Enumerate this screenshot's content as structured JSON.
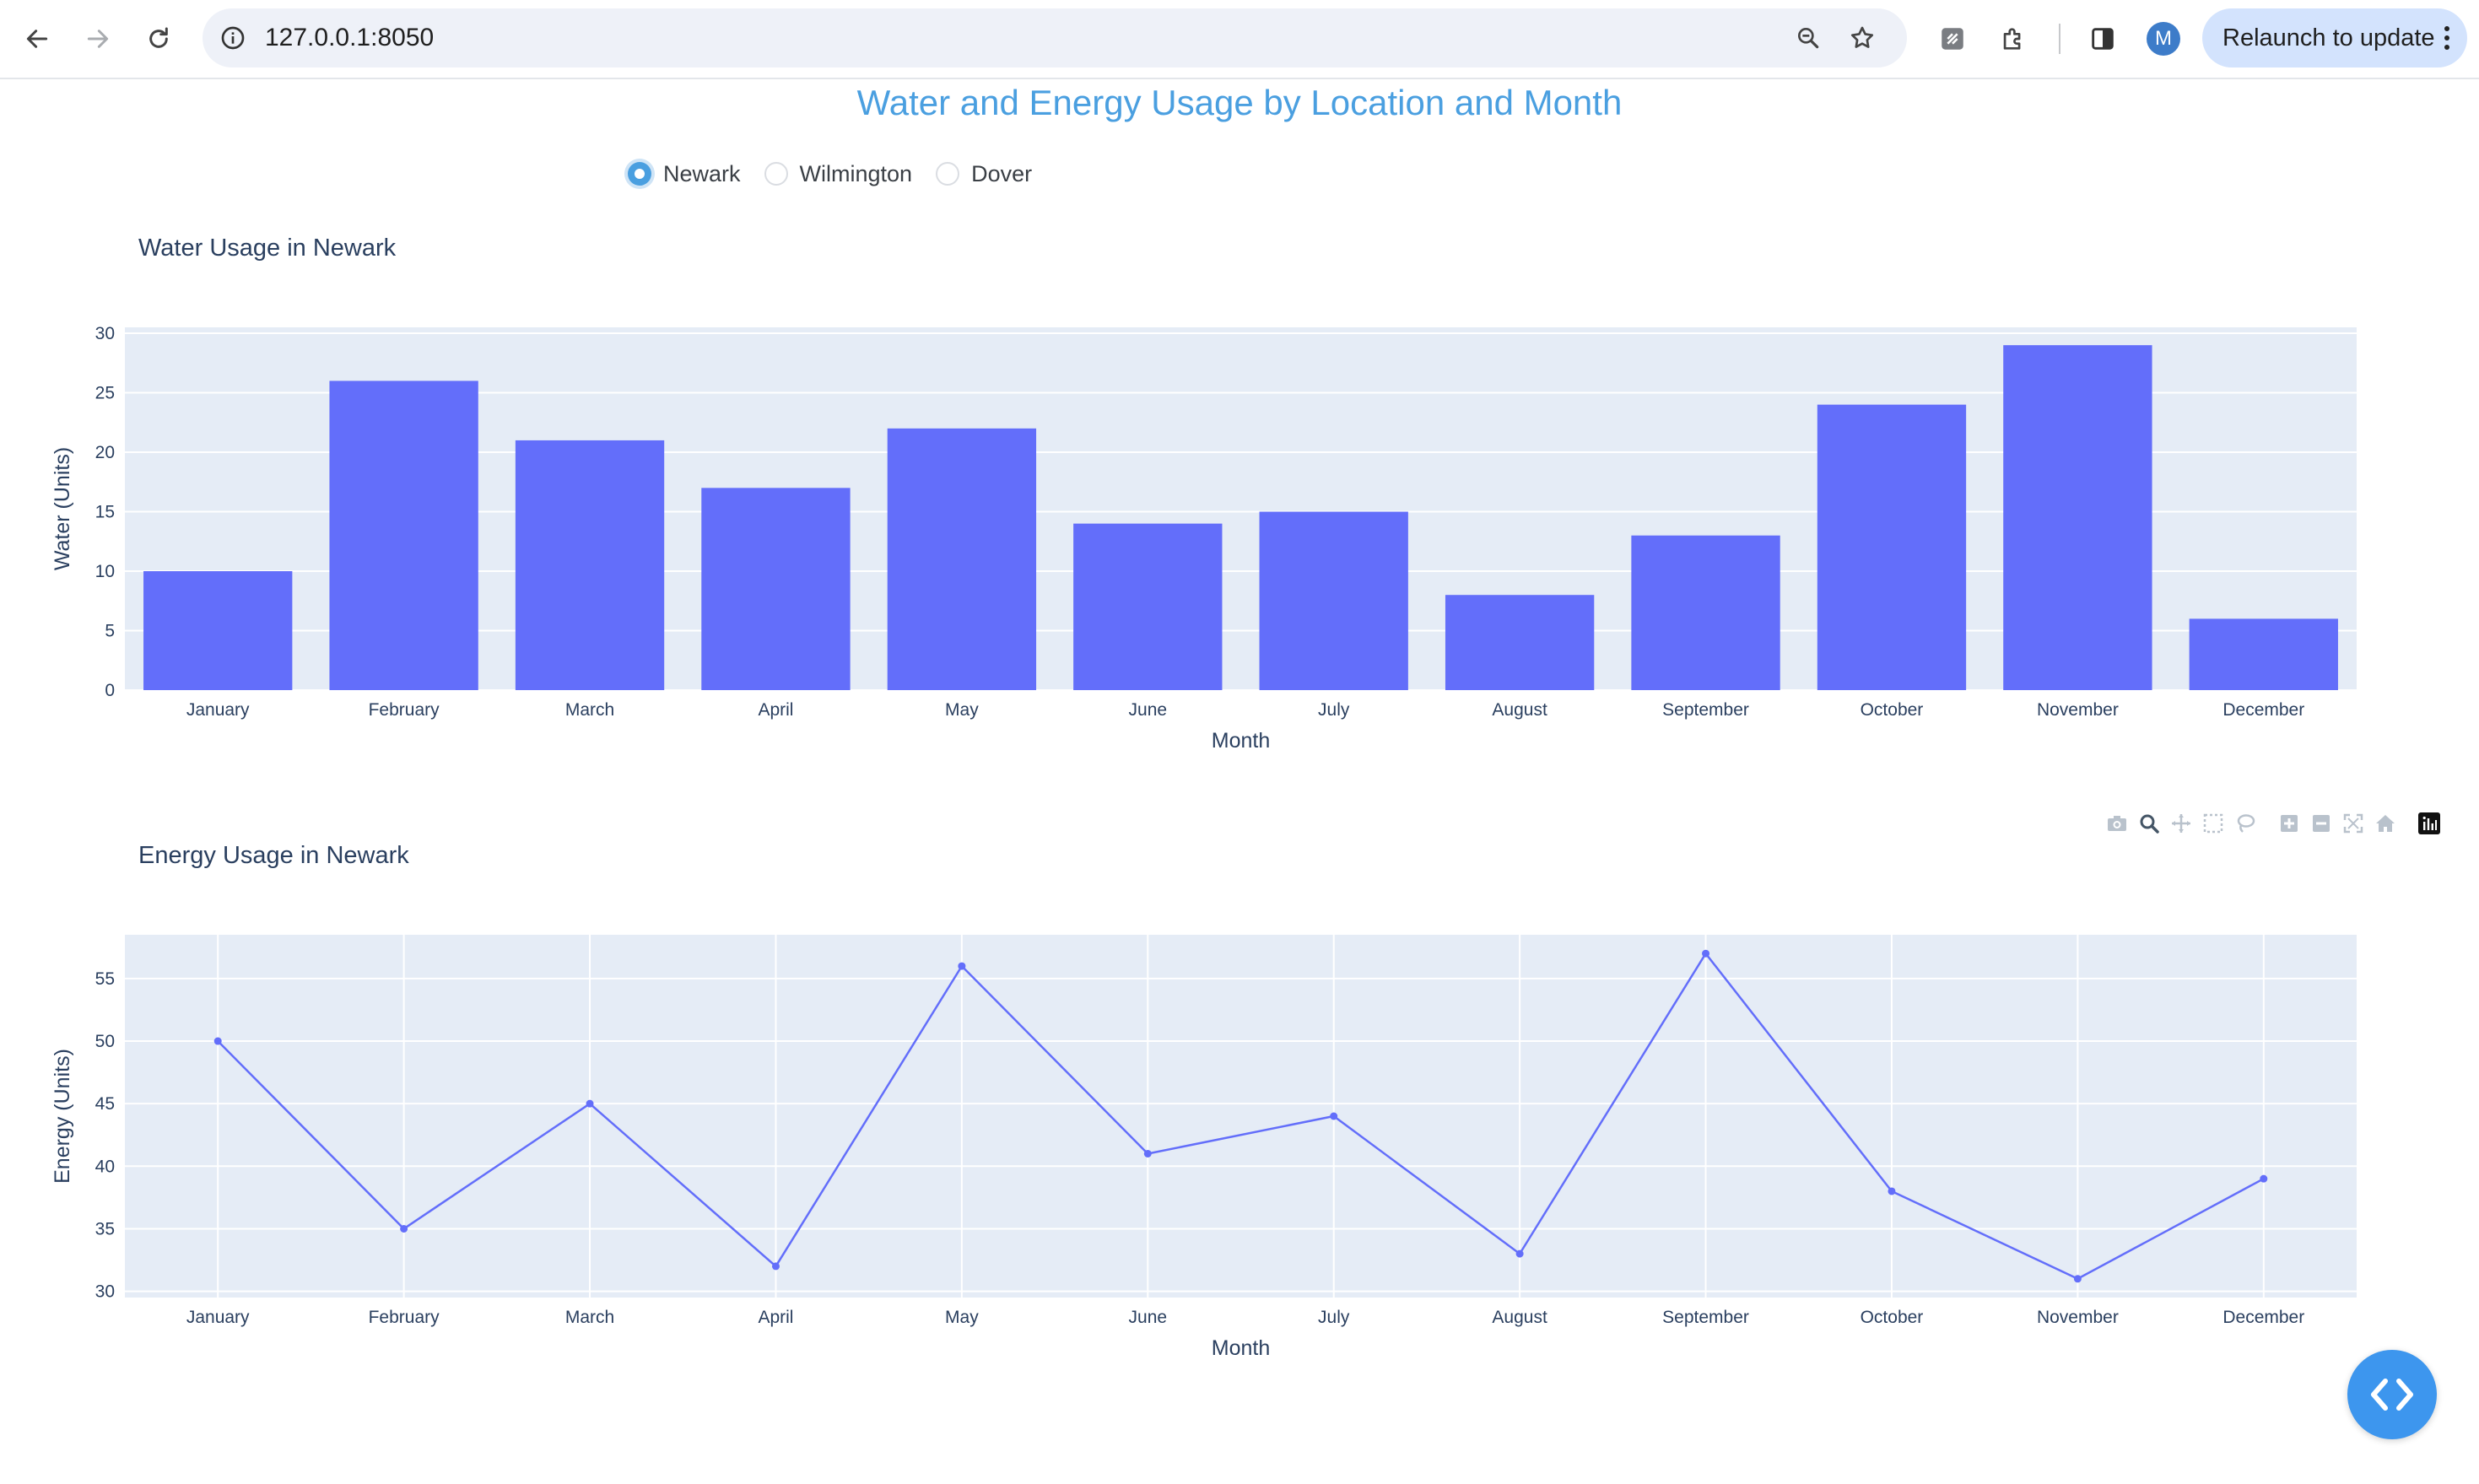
{
  "browser": {
    "url": "127.0.0.1:8050",
    "avatar_initial": "M",
    "relaunch_label": "Relaunch to update",
    "icons": [
      "back-arrow-icon",
      "forward-arrow-icon",
      "reload-icon",
      "info-icon",
      "zoom-icon",
      "bookmark-star-icon",
      "extension-icon",
      "puzzle-icon",
      "side-panel-icon",
      "kebab-menu-icon"
    ]
  },
  "page": {
    "title": "Water and Energy Usage by Location and Month",
    "title_color": "#4a9fe0",
    "location_options": [
      {
        "label": "Newark",
        "checked": true
      },
      {
        "label": "Wilmington",
        "checked": false
      },
      {
        "label": "Dover",
        "checked": false
      }
    ]
  },
  "modebar": {
    "icons": [
      "camera-icon",
      "zoom-icon",
      "pan-icon",
      "box-select-icon",
      "lasso-select-icon",
      "zoom-in-icon",
      "zoom-out-icon",
      "autoscale-icon",
      "reset-axes-icon",
      "plotly-logo-icon"
    ]
  },
  "fab": {
    "icon": "code-brackets-icon",
    "color": "#3d96ee"
  },
  "chart_data": [
    {
      "type": "bar",
      "title": "Water Usage in Newark",
      "xlabel": "Month",
      "ylabel": "Water (Units)",
      "categories": [
        "January",
        "February",
        "March",
        "April",
        "May",
        "June",
        "July",
        "August",
        "September",
        "October",
        "November",
        "December"
      ],
      "values": [
        10,
        26,
        21,
        17,
        22,
        14,
        15,
        8,
        13,
        24,
        29,
        6
      ],
      "yticks": [
        "0",
        "5",
        "10",
        "15",
        "20",
        "25",
        "30"
      ],
      "ylim": [
        0,
        30.5
      ],
      "grid": true,
      "color": "#636efa",
      "plot_bgcolor": "#e5ecf6"
    },
    {
      "type": "line",
      "title": "Energy Usage in Newark",
      "xlabel": "Month",
      "ylabel": "Energy (Units)",
      "categories": [
        "January",
        "February",
        "March",
        "April",
        "May",
        "June",
        "July",
        "August",
        "September",
        "October",
        "November",
        "December"
      ],
      "values": [
        50,
        35,
        45,
        32,
        56,
        41,
        44,
        33,
        57,
        38,
        31,
        39
      ],
      "yticks": [
        "30",
        "35",
        "40",
        "45",
        "50",
        "55"
      ],
      "ylim": [
        29.5,
        58.5
      ],
      "grid": true,
      "color": "#636efa",
      "plot_bgcolor": "#e5ecf6"
    }
  ]
}
